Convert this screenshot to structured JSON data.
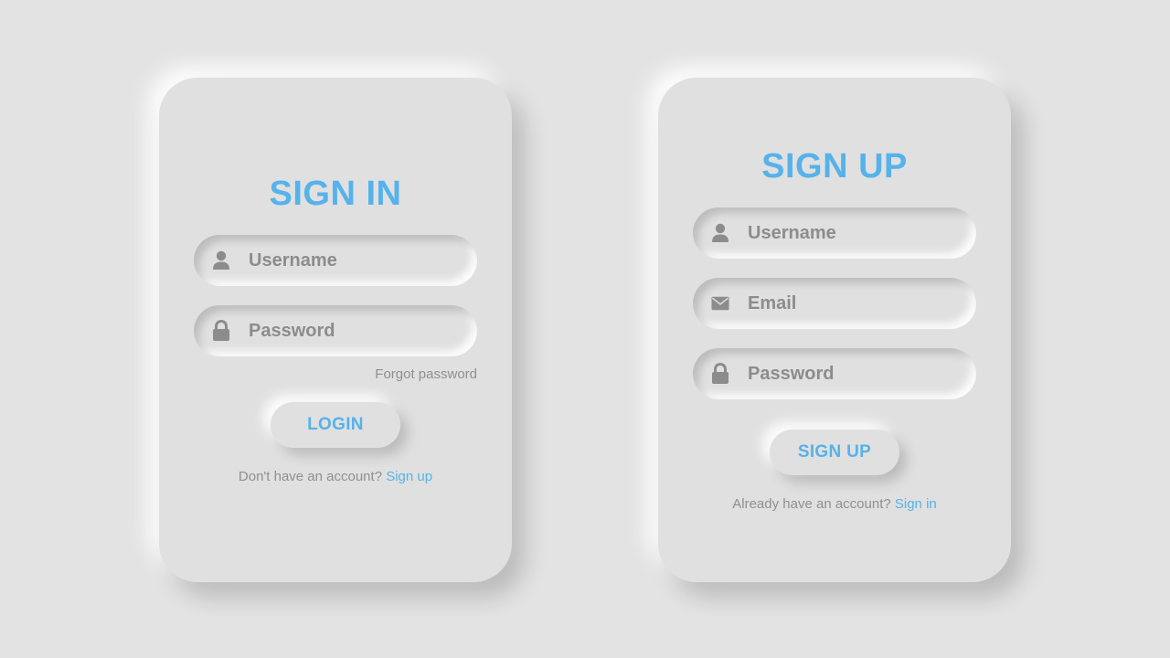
{
  "colors": {
    "background": "#e3e3e3",
    "card": "#e0e0e0",
    "accent": "#56b2ea",
    "muted_text": "#8c8c8c"
  },
  "signin": {
    "title": "SIGN IN",
    "username": {
      "icon": "user-icon",
      "placeholder": "Username"
    },
    "password": {
      "icon": "lock-icon",
      "placeholder": "Password"
    },
    "forgot_password": "Forgot password",
    "button_label": "LOGIN",
    "footer_text": "Don't have an account?",
    "footer_link": "Sign up"
  },
  "signup": {
    "title": "SIGN UP",
    "username": {
      "icon": "user-icon",
      "placeholder": "Username"
    },
    "email": {
      "icon": "envelope-icon",
      "placeholder": "Email"
    },
    "password": {
      "icon": "lock-icon",
      "placeholder": "Password"
    },
    "button_label": "SIGN UP",
    "footer_text": "Already have an account?",
    "footer_link": "Sign in"
  }
}
